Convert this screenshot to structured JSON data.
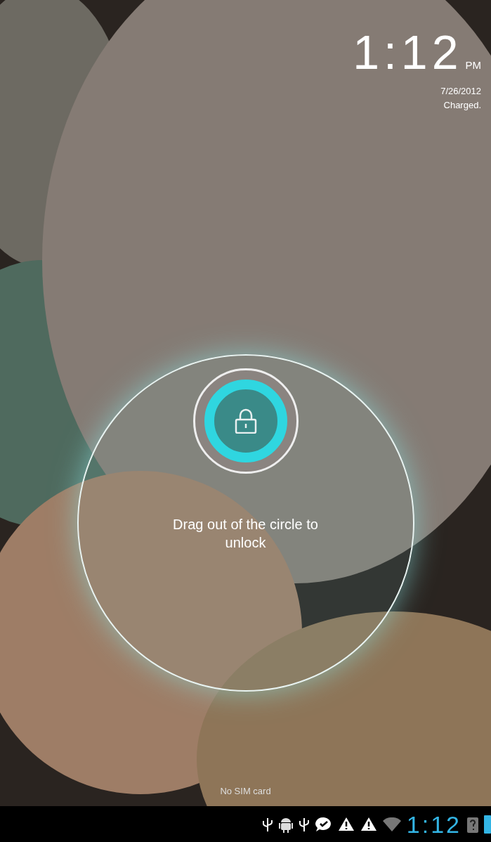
{
  "clock": {
    "time": "1:12",
    "ampm": "PM",
    "date": "7/26/2012",
    "battery_status": "Charged."
  },
  "unlock": {
    "hint": "Drag out of the circle to unlock"
  },
  "carrier": "No SIM card",
  "status_bar": {
    "icons": [
      {
        "kind": "usb"
      },
      {
        "kind": "android"
      },
      {
        "kind": "usb"
      },
      {
        "kind": "chat"
      },
      {
        "kind": "warning"
      },
      {
        "kind": "warning"
      },
      {
        "kind": "wifi"
      }
    ],
    "time": "1:12"
  }
}
